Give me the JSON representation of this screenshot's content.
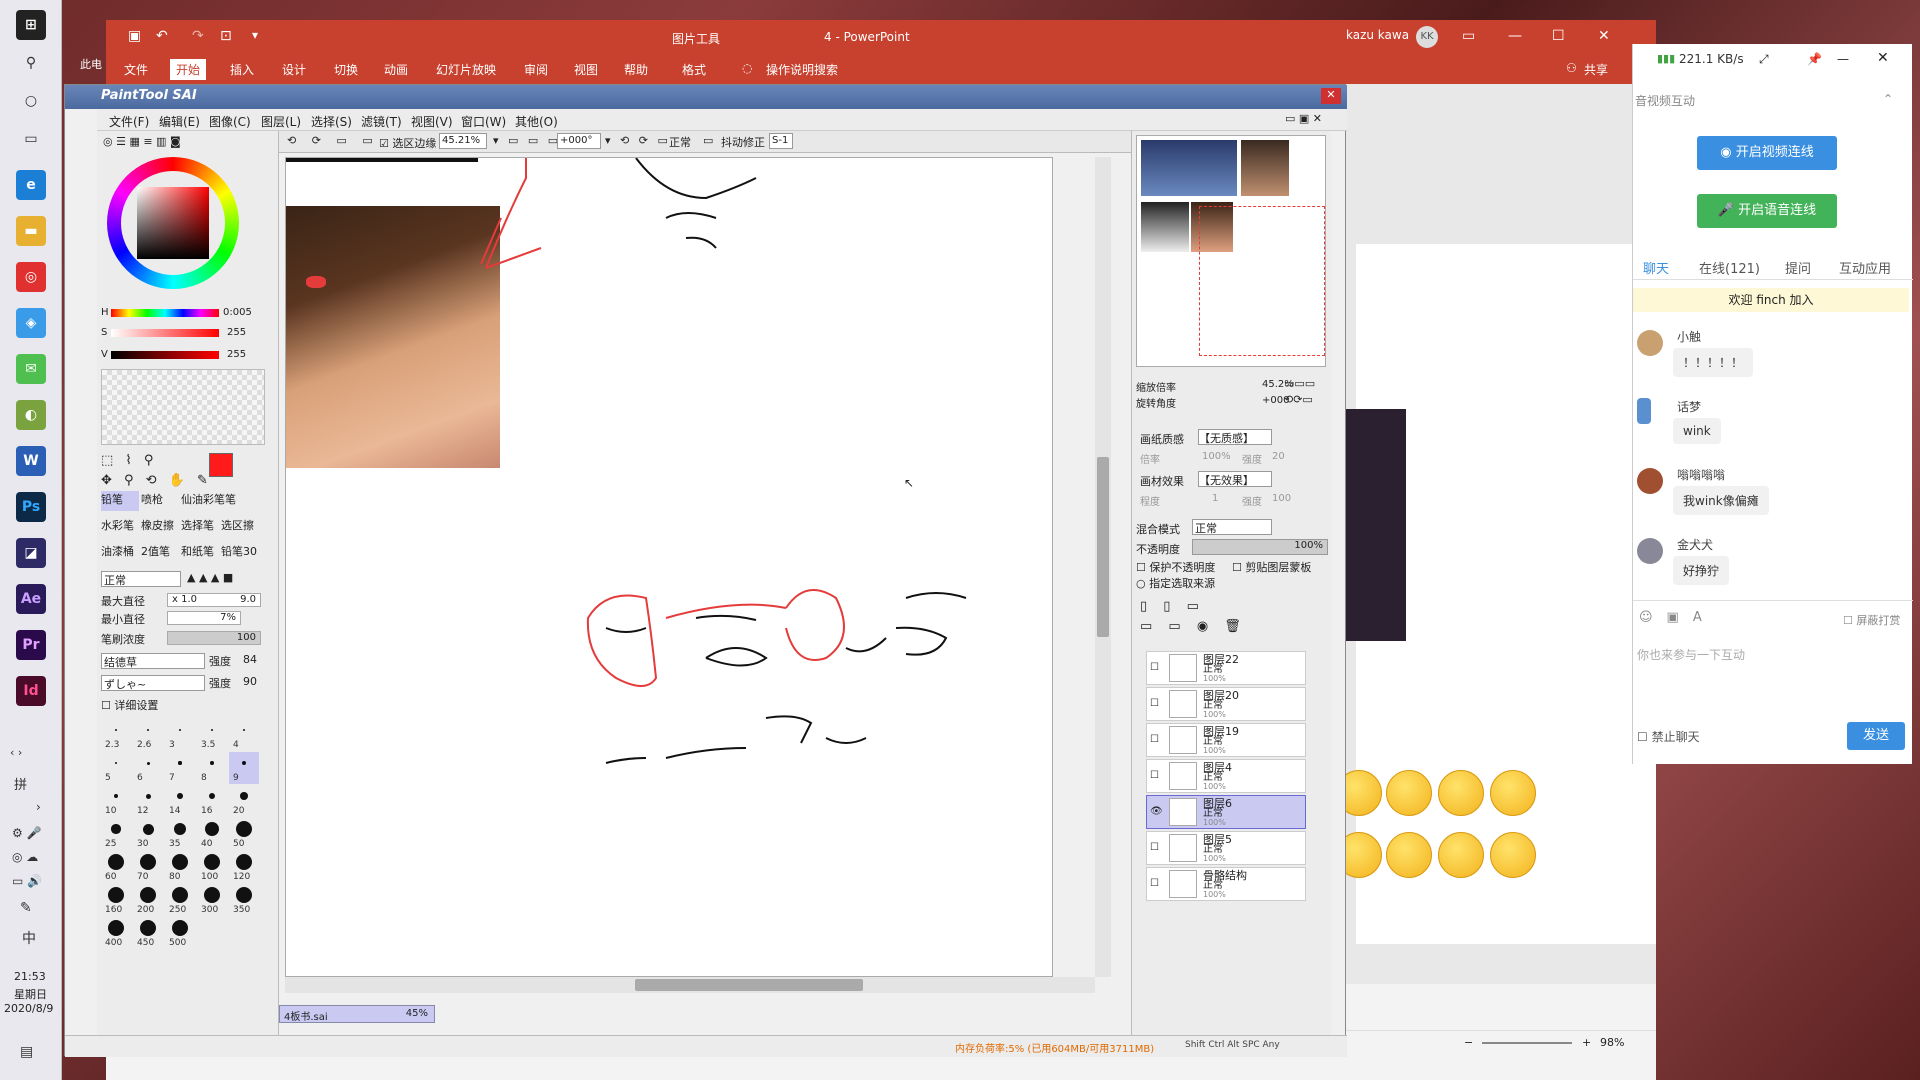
{
  "taskbar": {
    "time": "21:53",
    "weekday": "星期日",
    "date": "2020/8/9",
    "ime": "中",
    "ime2": "拼",
    "desktop_label": "此电"
  },
  "powerpoint": {
    "title": "4 - PowerPoint",
    "context_tool": "图片工具",
    "user": "kazu kawa",
    "user_initials": "KK",
    "tabs": [
      "文件",
      "开始",
      "插入",
      "设计",
      "切换",
      "动画",
      "幻灯片放映",
      "审阅",
      "视图",
      "帮助",
      "格式"
    ],
    "search_hint": "操作说明搜索",
    "share": "共享",
    "zoom": "98%"
  },
  "sai": {
    "title": "PaintTool SAI",
    "menu": [
      "文件(F)",
      "编辑(E)",
      "图像(C)",
      "图层(L)",
      "选择(S)",
      "滤镜(T)",
      "视图(V)",
      "窗口(W)",
      "其他(O)"
    ],
    "toolbar": {
      "selection_edge": "选区边缘",
      "zoom": "45.21%",
      "rotate": "+000°",
      "blend": "正常",
      "stabilizer": "抖动修正",
      "stabilizer_val": "S-1"
    },
    "hsv": {
      "h_label": "H",
      "h_val": "0:005",
      "s_label": "S",
      "s_val": "255",
      "v_label": "V",
      "v_val": "255"
    },
    "tools": [
      "铅笔",
      "喷枪",
      "仙油彩笔",
      "笔",
      "水彩笔",
      "橡皮擦",
      "选择笔",
      "选区擦",
      "油漆桶",
      "2值笔",
      "和纸笔",
      "铅笔30"
    ],
    "brush_mode": "正常",
    "max_size_label": "最大直径",
    "max_size_mult": "x 1.0",
    "max_size_val": "9.0",
    "min_size_label": "最小直径",
    "min_size_val": "7%",
    "density_label": "笔刷浓度",
    "density_val": "100",
    "texture": "结德草",
    "texture_strength_label": "强度",
    "texture_strength": "84",
    "edge": "ずしゃ~",
    "edge_strength_label": "强度",
    "edge_strength": "90",
    "detail_label": "详细设置",
    "brush_sizes": [
      "2.3",
      "2.6",
      "3",
      "3.5",
      "4",
      "5",
      "6",
      "7",
      "8",
      "9",
      "10",
      "12",
      "14",
      "16",
      "20",
      "25",
      "30",
      "35",
      "40",
      "50",
      "60",
      "70",
      "80",
      "100",
      "120",
      "160",
      "200",
      "250",
      "300",
      "350",
      "400",
      "450",
      "500"
    ],
    "navigator": {
      "zoom_label": "缩放倍率",
      "zoom_val": "45.2%",
      "angle_label": "旋转角度",
      "angle_val": "+000"
    },
    "paper_texture_label": "画纸质感",
    "paper_texture_val": "【无质感】",
    "paper_scale_label": "倍率",
    "paper_scale_val": "100%",
    "paper_strength_label": "强度",
    "paper_strength_val": "20",
    "paper_effect_label": "画材效果",
    "paper_effect_val": "【无效果】",
    "effect_degree_label": "程度",
    "effect_degree_val": "1",
    "effect_strength_label": "强度",
    "effect_strength_val": "100",
    "blend_label": "混合模式",
    "blend_val": "正常",
    "opacity_label": "不透明度",
    "opacity_val": "100%",
    "preserve_opacity": "保护不透明度",
    "clip_layer": "剪贴图层蒙板",
    "selection_source": "指定选取来源",
    "layers": [
      {
        "name": "图层22",
        "mode": "正常",
        "pct": "100%"
      },
      {
        "name": "图层20",
        "mode": "正常",
        "pct": "100%"
      },
      {
        "name": "图层19",
        "mode": "正常",
        "pct": "100%"
      },
      {
        "name": "图层4",
        "mode": "正常",
        "pct": "100%"
      },
      {
        "name": "图层6",
        "mode": "正常",
        "pct": "100%"
      },
      {
        "name": "图层5",
        "mode": "正常",
        "pct": "100%"
      },
      {
        "name": "骨骼结构",
        "mode": "正常",
        "pct": "100%"
      }
    ],
    "doc_tab": "4板书.sai",
    "doc_tab_pct": "45%",
    "status_memory": "内存负荷率:5% (已用604MB/可用3711MB)",
    "status_keys": "Shift Ctrl Alt SPC Any"
  },
  "chat": {
    "net_speed": "221.1 KB/s",
    "section_title": "音视频互动",
    "video_btn": "开启视频连线",
    "audio_btn": "开启语音连线",
    "tabs": [
      "聊天",
      "在线(121)",
      "提问",
      "互动应用"
    ],
    "welcome": "欢迎 finch 加入",
    "messages": [
      {
        "name": "小触",
        "text": "！！！！！"
      },
      {
        "name": "话梦",
        "text": "wink"
      },
      {
        "name": "嗡嗡嗡嗡",
        "text": "我wink像偏瘫"
      },
      {
        "name": "金犬犬",
        "text": "好挣狞"
      }
    ],
    "input_placeholder": "你也来参与一下互动",
    "block_label": "屏蔽打赏",
    "ban_chat": "禁止聊天",
    "send": "发送"
  },
  "colors": {
    "ppt_red": "#c8412f",
    "fg_color": "#ff1b1b",
    "active_layer": "#c9c9f2",
    "blue_btn": "#3a8fe0",
    "green_btn": "#43b35a"
  }
}
